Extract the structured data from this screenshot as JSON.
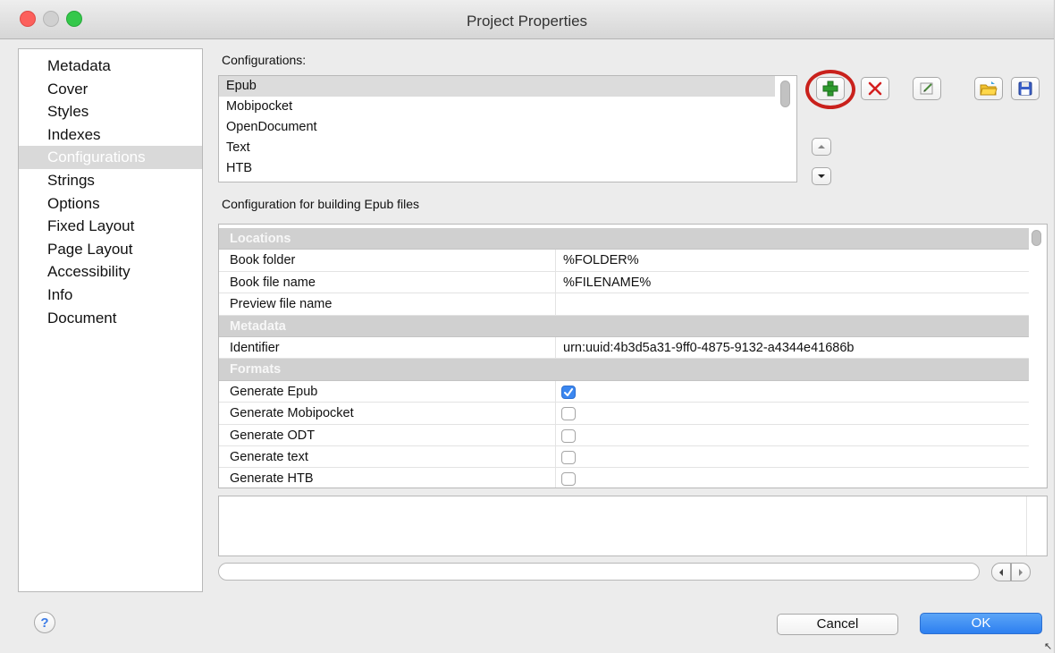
{
  "window": {
    "title": "Project Properties"
  },
  "sidebar": {
    "items": [
      {
        "label": "Metadata",
        "selected": false
      },
      {
        "label": "Cover",
        "selected": false
      },
      {
        "label": "Styles",
        "selected": false
      },
      {
        "label": "Indexes",
        "selected": false
      },
      {
        "label": "Configurations",
        "selected": true
      },
      {
        "label": "Strings",
        "selected": false
      },
      {
        "label": "Options",
        "selected": false
      },
      {
        "label": "Fixed Layout",
        "selected": false
      },
      {
        "label": "Page Layout",
        "selected": false
      },
      {
        "label": "Accessibility",
        "selected": false
      },
      {
        "label": "Info",
        "selected": false
      },
      {
        "label": "Document",
        "selected": false
      }
    ]
  },
  "configurations": {
    "label": "Configurations:",
    "items": [
      {
        "label": "Epub",
        "selected": true
      },
      {
        "label": "Mobipocket",
        "selected": false
      },
      {
        "label": "OpenDocument",
        "selected": false
      },
      {
        "label": "Text",
        "selected": false
      },
      {
        "label": "HTB",
        "selected": false
      }
    ]
  },
  "toolbar": {
    "icons": [
      "add-icon",
      "delete-icon",
      "edit-icon",
      "open-folder-icon",
      "save-icon",
      "move-up-icon",
      "move-down-icon"
    ],
    "colors": {
      "add": "#2e9b2e",
      "delete": "#d42020",
      "highlight_ring": "#c9211c"
    }
  },
  "config_detail": {
    "label": "Configuration for building Epub files",
    "rows": [
      {
        "type": "section",
        "key": "Locations"
      },
      {
        "type": "text",
        "key": "Book folder",
        "value": "%FOLDER%"
      },
      {
        "type": "text",
        "key": "Book file name",
        "value": "%FILENAME%"
      },
      {
        "type": "text",
        "key": "Preview file name",
        "value": ""
      },
      {
        "type": "section",
        "key": "Metadata"
      },
      {
        "type": "text",
        "key": "Identifier",
        "value": "urn:uuid:4b3d5a31-9ff0-4875-9132-a4344e41686b"
      },
      {
        "type": "section",
        "key": "Formats"
      },
      {
        "type": "checkbox",
        "key": "Generate Epub",
        "checked": true
      },
      {
        "type": "checkbox",
        "key": "Generate Mobipocket",
        "checked": false
      },
      {
        "type": "checkbox",
        "key": "Generate ODT",
        "checked": false
      },
      {
        "type": "checkbox",
        "key": "Generate text",
        "checked": false
      },
      {
        "type": "checkbox",
        "key": "Generate HTB",
        "checked": false
      }
    ]
  },
  "footer": {
    "help_label": "?",
    "cancel_label": "Cancel",
    "ok_label": "OK",
    "accent_color": "#2d7ff0"
  }
}
